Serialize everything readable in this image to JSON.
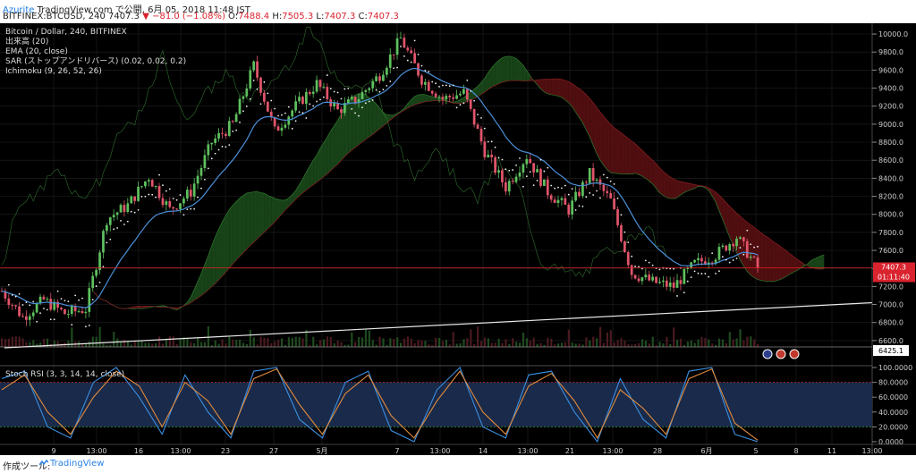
{
  "header": {
    "author": "Azurite",
    "published": "TradingView.com で公開, 6月 05, 2018 11:48 JST",
    "symbol_line": "BITFINEX:BTCUSD, 240",
    "last": "7407.3",
    "change": "▼ −81.0 (−1.08%)",
    "o_label": "O:",
    "o": "7488.4",
    "h_label": "H:",
    "h": "7505.3",
    "l_label": "L:",
    "l": "7407.3",
    "c_label": "C:",
    "c": "7407.3"
  },
  "legend": [
    "Bitcoin / Dollar, 240, BITFINEX",
    "出来高 (20)",
    "EMA (20, close)",
    "SAR (ストップアンドリバース) (0.02, 0.02, 0.2)",
    "Ichimoku (9, 26, 52, 26)"
  ],
  "colors": {
    "up": "#5ec05e",
    "down": "#e0556a",
    "ema": "#4a90d9",
    "kumo_bull": "#1b4a1b",
    "kumo_bear": "#5a0f12",
    "price_line": "#e02020",
    "stoch_k": "#3b8fe0",
    "stoch_d": "#e08a3c"
  },
  "price_tag": {
    "value": "7407.3",
    "countdown": "01:11:40"
  },
  "low_tag": "6425.1",
  "stoch_title": "Stoch RSI (3, 3, 14, 14, close)",
  "footer": {
    "label": "作成ツール:",
    "brand": "TradingView"
  },
  "chart_data": [
    {
      "type": "candlestick",
      "title": "Bitcoin / Dollar, 240, BITFINEX",
      "x_ticks": [
        "9",
        "13:00",
        "16",
        "13:00",
        "23",
        "27",
        "5月",
        "7",
        "13:00",
        "14",
        "13:00",
        "21",
        "13:00",
        "28",
        "6月",
        "5",
        "8",
        "11",
        "13:00"
      ],
      "y_ticks": [
        6600,
        6800,
        7000,
        7200,
        7400,
        7600,
        7800,
        8000,
        8200,
        8400,
        8600,
        8800,
        9000,
        9200,
        9400,
        9600,
        9800,
        10000
      ],
      "ylim": [
        6450,
        10080
      ],
      "close_path": [
        {
          "x": 0,
          "y": 7150
        },
        {
          "x": 6,
          "y": 6860
        },
        {
          "x": 12,
          "y": 7050
        },
        {
          "x": 18,
          "y": 6900
        },
        {
          "x": 24,
          "y": 6950
        },
        {
          "x": 30,
          "y": 7950
        },
        {
          "x": 36,
          "y": 8100
        },
        {
          "x": 42,
          "y": 8420
        },
        {
          "x": 48,
          "y": 8050
        },
        {
          "x": 54,
          "y": 8250
        },
        {
          "x": 60,
          "y": 8800
        },
        {
          "x": 66,
          "y": 9000
        },
        {
          "x": 72,
          "y": 9650
        },
        {
          "x": 78,
          "y": 8920
        },
        {
          "x": 84,
          "y": 9200
        },
        {
          "x": 90,
          "y": 9450
        },
        {
          "x": 96,
          "y": 9150
        },
        {
          "x": 102,
          "y": 9300
        },
        {
          "x": 108,
          "y": 9550
        },
        {
          "x": 114,
          "y": 9950
        },
        {
          "x": 120,
          "y": 9500
        },
        {
          "x": 126,
          "y": 9280
        },
        {
          "x": 132,
          "y": 9350
        },
        {
          "x": 138,
          "y": 8700
        },
        {
          "x": 144,
          "y": 8300
        },
        {
          "x": 150,
          "y": 8650
        },
        {
          "x": 156,
          "y": 8250
        },
        {
          "x": 162,
          "y": 8050
        },
        {
          "x": 168,
          "y": 8450
        },
        {
          "x": 174,
          "y": 8150
        },
        {
          "x": 180,
          "y": 7350
        },
        {
          "x": 186,
          "y": 7250
        },
        {
          "x": 192,
          "y": 7200
        },
        {
          "x": 198,
          "y": 7450
        },
        {
          "x": 204,
          "y": 7550
        },
        {
          "x": 210,
          "y": 7750
        },
        {
          "x": 216,
          "y": 7407
        }
      ],
      "ichimoku_cloud": "shown",
      "ema_20": "shown",
      "parabolic_sar": "shown",
      "current_price": 7407.3,
      "grid": true
    },
    {
      "type": "line",
      "title": "Stoch RSI (3, 3, 14, 14, close)",
      "y_ticks": [
        0,
        20,
        40,
        60,
        80,
        100
      ],
      "ylim": [
        0,
        100
      ],
      "series": [
        {
          "values": [
            85,
            95,
            20,
            5,
            80,
            100,
            60,
            10,
            90,
            40,
            5,
            95,
            100,
            30,
            5,
            80,
            95,
            15,
            0,
            70,
            100,
            20,
            5,
            90,
            95,
            40,
            0,
            85,
            30,
            5,
            95,
            100,
            10,
            0
          ]
        },
        {
          "values": [
            70,
            90,
            40,
            10,
            60,
            95,
            75,
            20,
            80,
            55,
            10,
            85,
            98,
            50,
            10,
            65,
            90,
            35,
            5,
            55,
            95,
            40,
            10,
            75,
            92,
            55,
            5,
            70,
            45,
            10,
            85,
            98,
            25,
            2
          ]
        }
      ]
    }
  ]
}
